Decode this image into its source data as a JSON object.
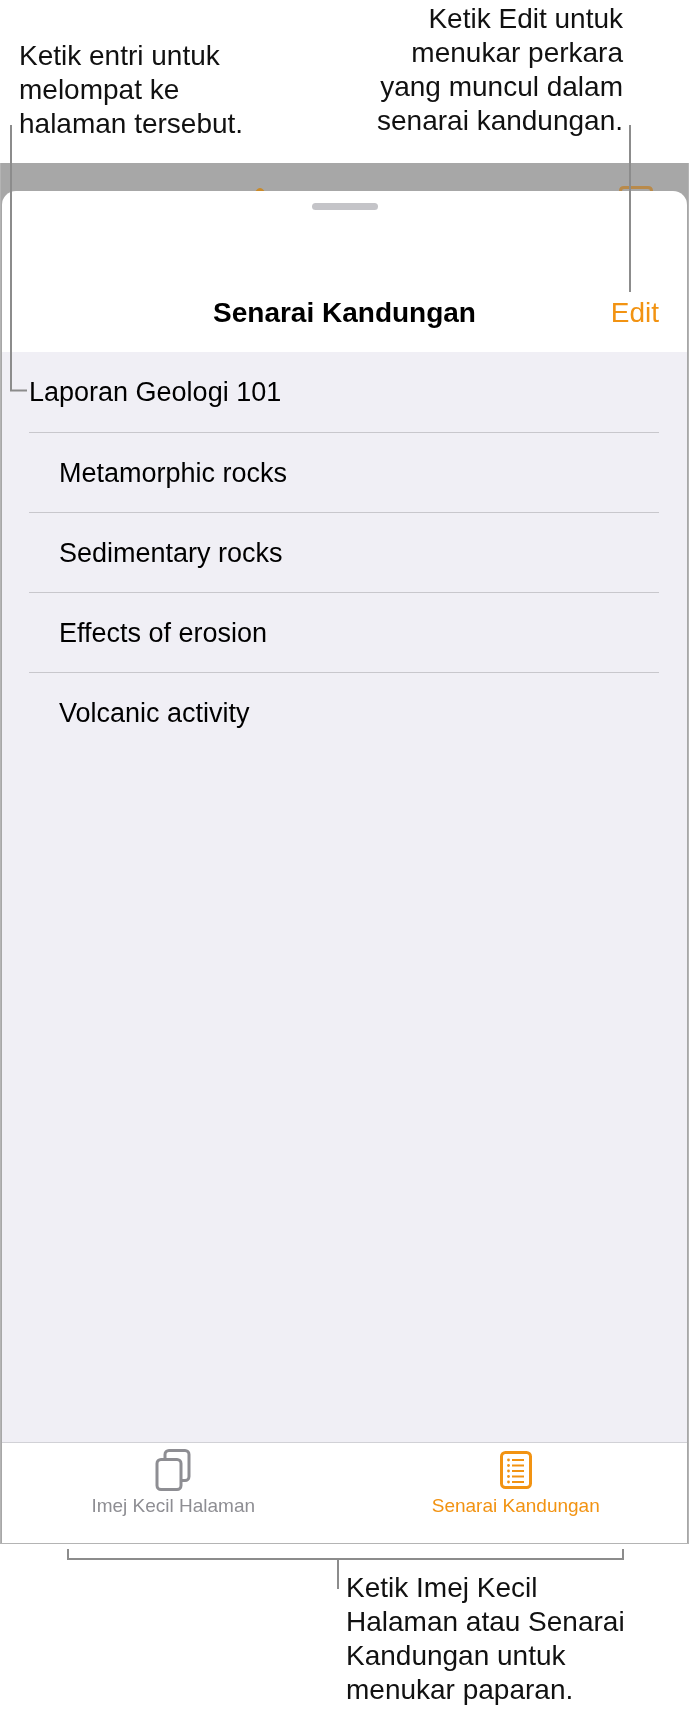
{
  "callout_left": "Ketik entri untuk melompat ke halaman tersebut.",
  "callout_right": "Ketik Edit untuk menukar perkara yang muncul dalam senarai kandungan.",
  "sheet": {
    "title": "Senarai Kandungan",
    "edit_button": "Edit"
  },
  "contents": [
    {
      "label": "Laporan Geologi 101",
      "children": [
        {
          "label": "Metamorphic rocks"
        },
        {
          "label": "Sedimentary rocks"
        },
        {
          "label": "Effects of erosion"
        },
        {
          "label": "Volcanic activity"
        }
      ]
    }
  ],
  "tabs": [
    {
      "label": "Imej Kecil Halaman",
      "selected": false
    },
    {
      "label": "Senarai Kandungan",
      "selected": true
    }
  ],
  "callout_bottom": "Ketik Imej Kecil Halaman atau Senarai Kandungan untuk menukar paparan."
}
